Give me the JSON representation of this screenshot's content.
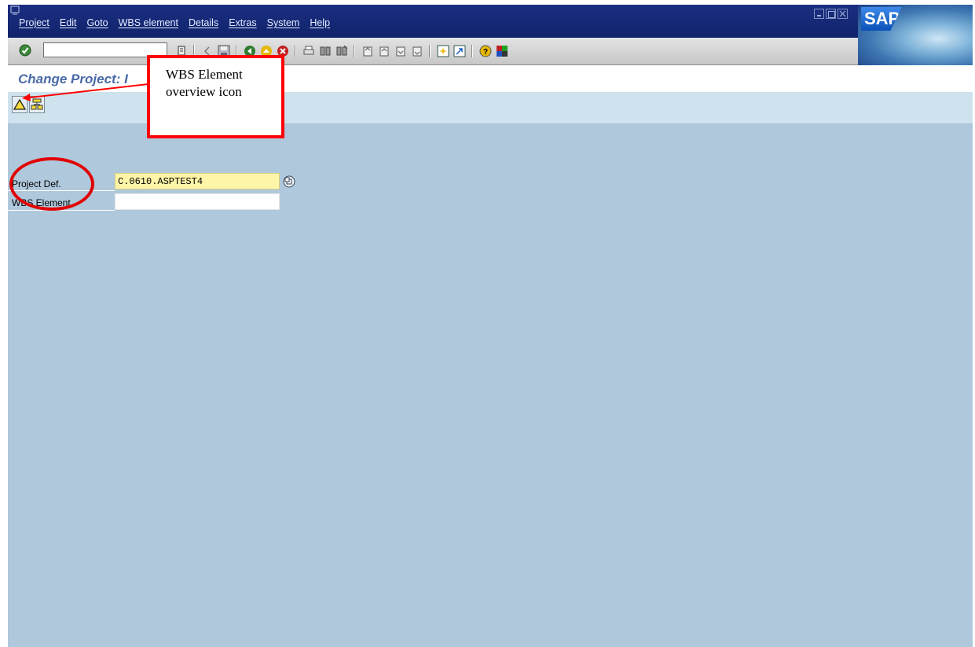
{
  "menu": {
    "items": [
      "Project",
      "Edit",
      "Goto",
      "WBS element",
      "Details",
      "Extras",
      "System",
      "Help"
    ]
  },
  "brand": {
    "logo": "SAP"
  },
  "toolbar": {
    "command_field_value": "",
    "icons": [
      "enter-icon",
      "command-history-icon",
      "back-arrow-icon",
      "save-icon",
      "back-icon",
      "exit-icon",
      "cancel-icon",
      "print-icon",
      "find-icon",
      "find-next-icon",
      "first-page-icon",
      "previous-page-icon",
      "next-page-icon",
      "last-page-icon",
      "create-session-icon",
      "shortcut-icon",
      "help-icon",
      "customize-layout-icon"
    ]
  },
  "page": {
    "title": "Change Project: I"
  },
  "app_toolbar": {
    "icons": [
      "wbs-element-overview-icon",
      "hierarchy-icon"
    ]
  },
  "form": {
    "project_def_label": "Project Def.",
    "project_def_value": "C.0610.ASPTEST4",
    "wbs_element_label": "WBS Element",
    "wbs_element_value": ""
  },
  "annotation": {
    "callout_line1": "WBS Element",
    "callout_line2": "overview icon",
    "color": "#ff0000"
  },
  "colors": {
    "menubar": "#10236a",
    "background": "#afc8db",
    "title": "#4a6aa8",
    "required_field": "#fff5a8"
  }
}
